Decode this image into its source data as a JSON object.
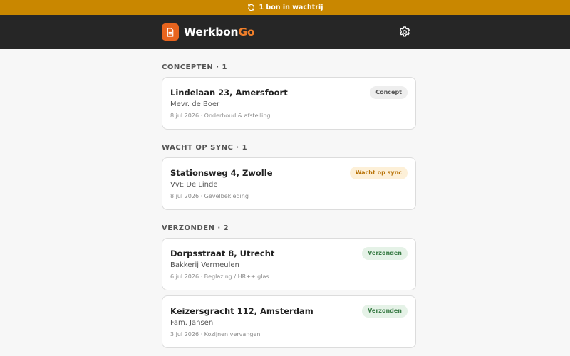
{
  "queue_banner": {
    "text": "1 bon in wachtrij",
    "icon": "refresh-icon",
    "color": "#c98700"
  },
  "header": {
    "brand_part1": "Werkbon",
    "brand_part2": "Go",
    "logo_icon": "document-icon",
    "settings_icon": "gear-icon",
    "accent": "#e8641e"
  },
  "sections": [
    {
      "title": "CONCEPTEN",
      "count": "1",
      "cards": [
        {
          "title": "Lindelaan 23, Amersfoort",
          "client": "Mevr. de Boer",
          "meta": "8 jul 2026 · Onderhoud & afstelling",
          "status": "Concept"
        }
      ]
    },
    {
      "title": "WACHT OP SYNC",
      "count": "1",
      "cards": [
        {
          "title": "Stationsweg 4, Zwolle",
          "client": "VvE De Linde",
          "meta": "8 jul 2026 · Gevelbekleding",
          "status": "Wacht op sync"
        }
      ]
    },
    {
      "title": "VERZONDEN",
      "count": "2",
      "cards": [
        {
          "title": "Dorpsstraat 8, Utrecht",
          "client": "Bakkerij Vermeulen",
          "meta": "6 jul 2026 · Beglazing / HR++ glas",
          "status": "Verzonden"
        },
        {
          "title": "Keizersgracht 112, Amsterdam",
          "client": "Fam. Jansen",
          "meta": "3 jul 2026 · Kozijnen vervangen",
          "status": "Verzonden"
        }
      ]
    }
  ]
}
